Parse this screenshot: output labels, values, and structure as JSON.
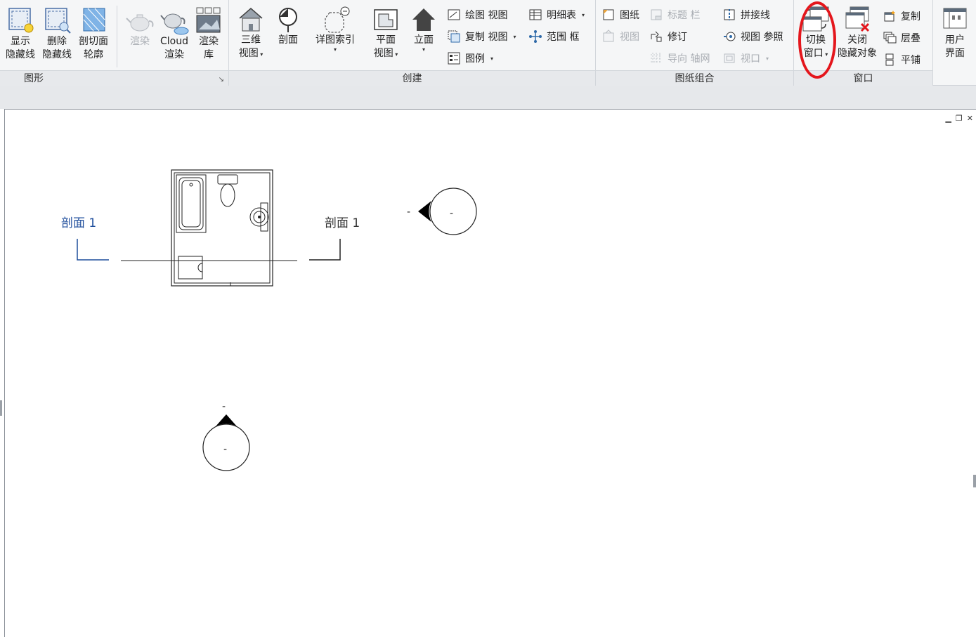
{
  "ribbon": {
    "graphics": {
      "label": "图形",
      "buttons": [
        {
          "line1": "显示",
          "line2": "隐藏线"
        },
        {
          "line1": "删除",
          "line2": "隐藏线"
        },
        {
          "line1": "剖切面",
          "line2": "轮廓"
        },
        {
          "line1": "渲染",
          "line2": ""
        },
        {
          "line1": "Cloud",
          "line2": "渲染"
        },
        {
          "line1": "渲染",
          "line2": "库"
        }
      ]
    },
    "create": {
      "label": "创建",
      "buttons": [
        {
          "line1": "三维",
          "line2": "视图"
        },
        {
          "line1": "剖面",
          "line2": ""
        },
        {
          "line1": "详图索引",
          "line2": ""
        },
        {
          "line1": "平面",
          "line2": "视图"
        },
        {
          "line1": "立面",
          "line2": ""
        }
      ],
      "small": [
        "绘图 视图",
        "复制 视图",
        "图例",
        "明细表",
        "范围 框"
      ]
    },
    "sheet": {
      "label": "图纸组合",
      "small": [
        "图纸",
        "视图",
        "标题 栏",
        "修订",
        "导向 轴网",
        "拼接线",
        "视图 参照",
        "视口"
      ]
    },
    "window": {
      "label": "窗口",
      "buttons": [
        {
          "line1": "切换",
          "line2": "窗口"
        },
        {
          "line1": "关闭",
          "line2": "隐藏对象"
        }
      ],
      "small": [
        "复制",
        "层叠",
        "平铺"
      ]
    },
    "ui": {
      "buttons": [
        {
          "line1": "用户",
          "line2": "界面"
        }
      ]
    }
  },
  "drawing": {
    "section_label_left": "剖面 1",
    "section_label_right": "剖面 1",
    "elevation_marker_right": "-",
    "elevation_marker_right_side": "-",
    "elevation_marker_bottom": "-",
    "elevation_marker_bottom_top": "-"
  },
  "colors": {
    "ribbon_bg": "#f5f6f7",
    "panel_label_bg": "#e7e9ec",
    "section_blue": "#1f4e9c",
    "highlight_red": "#e4161c"
  }
}
